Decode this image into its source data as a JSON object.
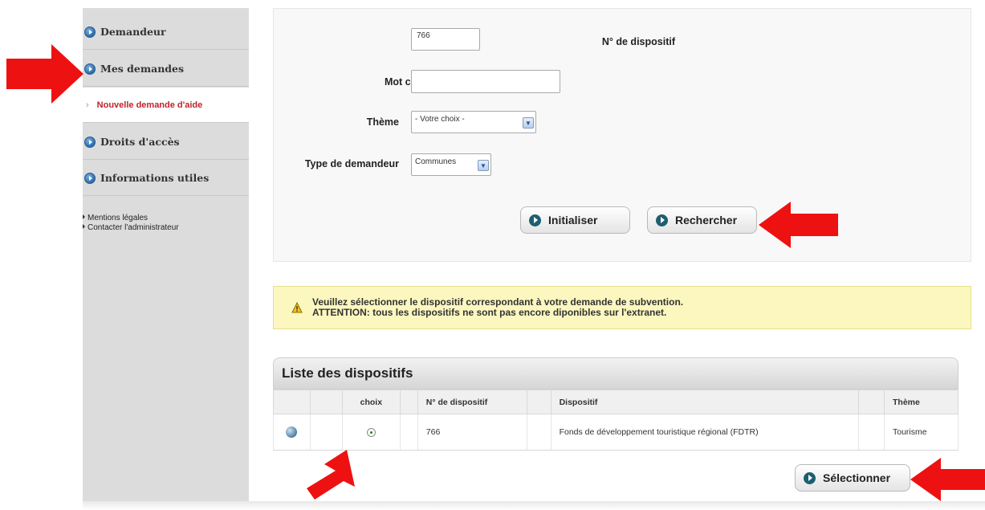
{
  "sidebar": {
    "items": [
      {
        "label": "Demandeur"
      },
      {
        "label": "Mes demandes"
      },
      {
        "label": "Nouvelle demande d'aide"
      },
      {
        "label": "Droits d'accès"
      },
      {
        "label": "Informations utiles"
      }
    ],
    "links": [
      "Mentions légales",
      "Contacter l'administrateur"
    ]
  },
  "search": {
    "dispositif_label": "N° de dispositif",
    "dispositif_value": "766",
    "motcle_label": "Mot clé",
    "motcle_value": "",
    "theme_label": "Thème",
    "theme_value": "- Votre choix -",
    "type_label": "Type de demandeur",
    "type_value": "Communes",
    "initialiser_label": "Initialiser",
    "rechercher_label": "Rechercher"
  },
  "warning": {
    "line1": "Veuillez sélectionner le dispositif correspondant à votre demande de subvention.",
    "line2": "ATTENTION: tous les dispositifs ne sont pas encore diponibles sur l'extranet."
  },
  "list": {
    "title": "Liste des dispositifs",
    "columns": [
      "",
      "",
      "choix",
      "",
      "N° de dispositif",
      "",
      "Dispositif",
      "",
      "Thème"
    ],
    "rows": [
      {
        "numero": "766",
        "dispositif": "Fonds de développement touristique régional (FDTR)",
        "theme": "Tourisme"
      }
    ],
    "select_label": "Sélectionner"
  },
  "colors": {
    "arrow": "#ee1111",
    "active_link": "#c0232b",
    "warning_bg": "#fbf7bf"
  },
  "icons": {
    "nav_bullet": "circle-arrow-icon",
    "button": "chevron-right-icon",
    "warning": "warning-triangle-icon",
    "row": "globe-icon"
  }
}
